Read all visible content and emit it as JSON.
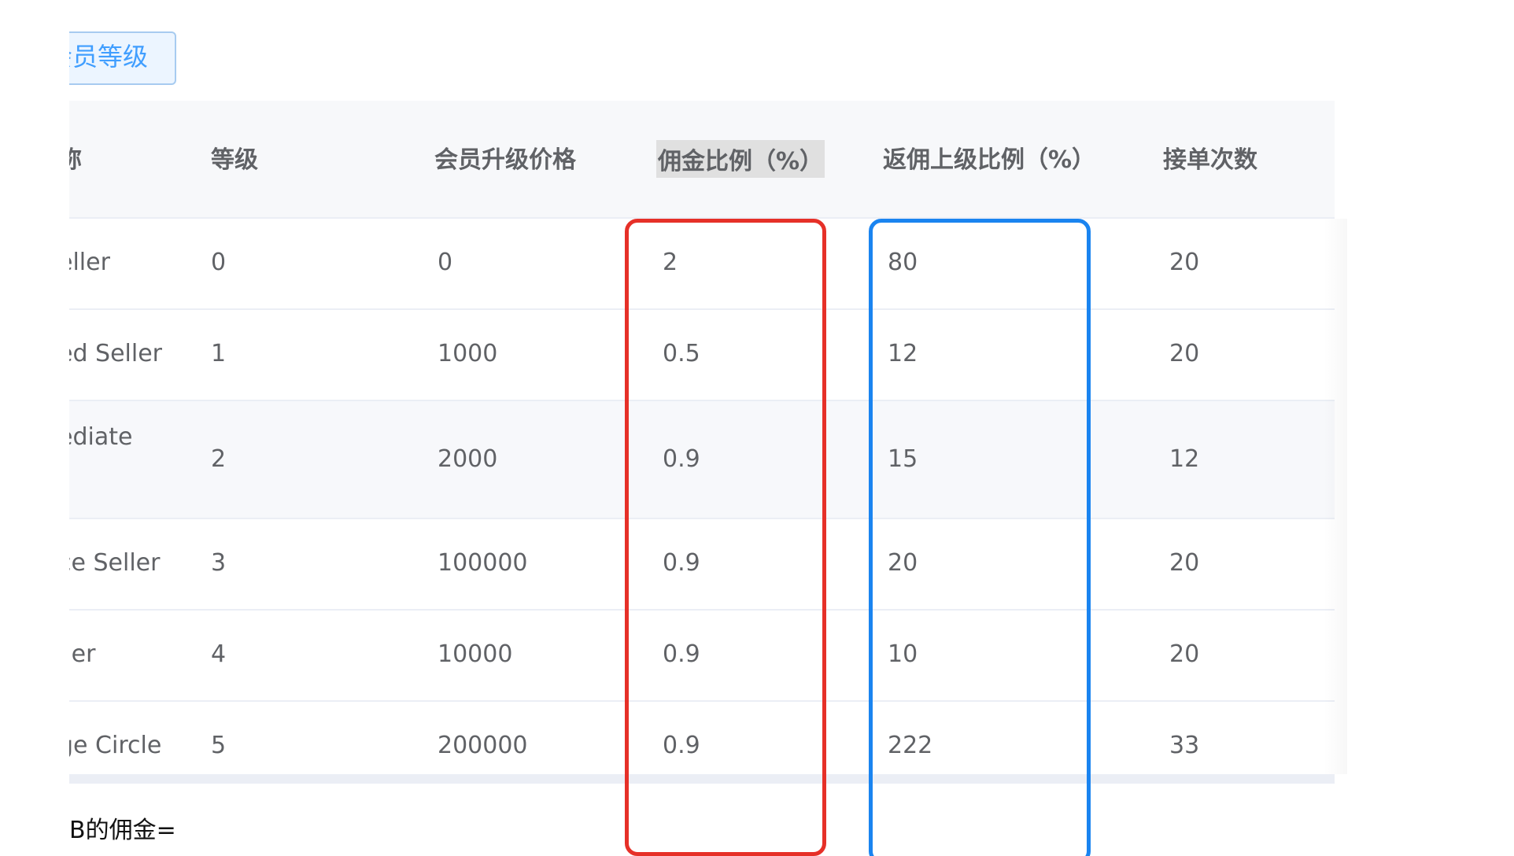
{
  "top_button": {
    "label": "会员等级"
  },
  "table": {
    "headers": [
      "称",
      "等级",
      "会员升级价格",
      "佣金比例（%）",
      "返佣上级比例（%）",
      "接单次数"
    ],
    "rows": [
      {
        "name": "eller",
        "level": "0",
        "price": "0",
        "commission": "2",
        "rebate": "80",
        "orders": "20"
      },
      {
        "name": "ed Seller",
        "level": "1",
        "price": "1000",
        "commission": "0.5",
        "rebate": "12",
        "orders": "20"
      },
      {
        "name": "ediate",
        "level": "2",
        "price": "2000",
        "commission": "0.9",
        "rebate": "15",
        "orders": "12"
      },
      {
        "name": "ce Seller",
        "level": "3",
        "price": "100000",
        "commission": "0.9",
        "rebate": "20",
        "orders": "20"
      },
      {
        "name": "ller",
        "level": "4",
        "price": "10000",
        "commission": "0.9",
        "rebate": "10",
        "orders": "20"
      },
      {
        "name": "ge Circle",
        "level": "5",
        "price": "200000",
        "commission": "0.9",
        "rebate": "222",
        "orders": "33"
      }
    ]
  },
  "formula_text": "B的佣金=",
  "colors": {
    "red_box": "#e63028",
    "blue_box": "#1a84f0",
    "header_bg": "#f7f8fa",
    "stripe_bg": "#f7f8fb"
  }
}
